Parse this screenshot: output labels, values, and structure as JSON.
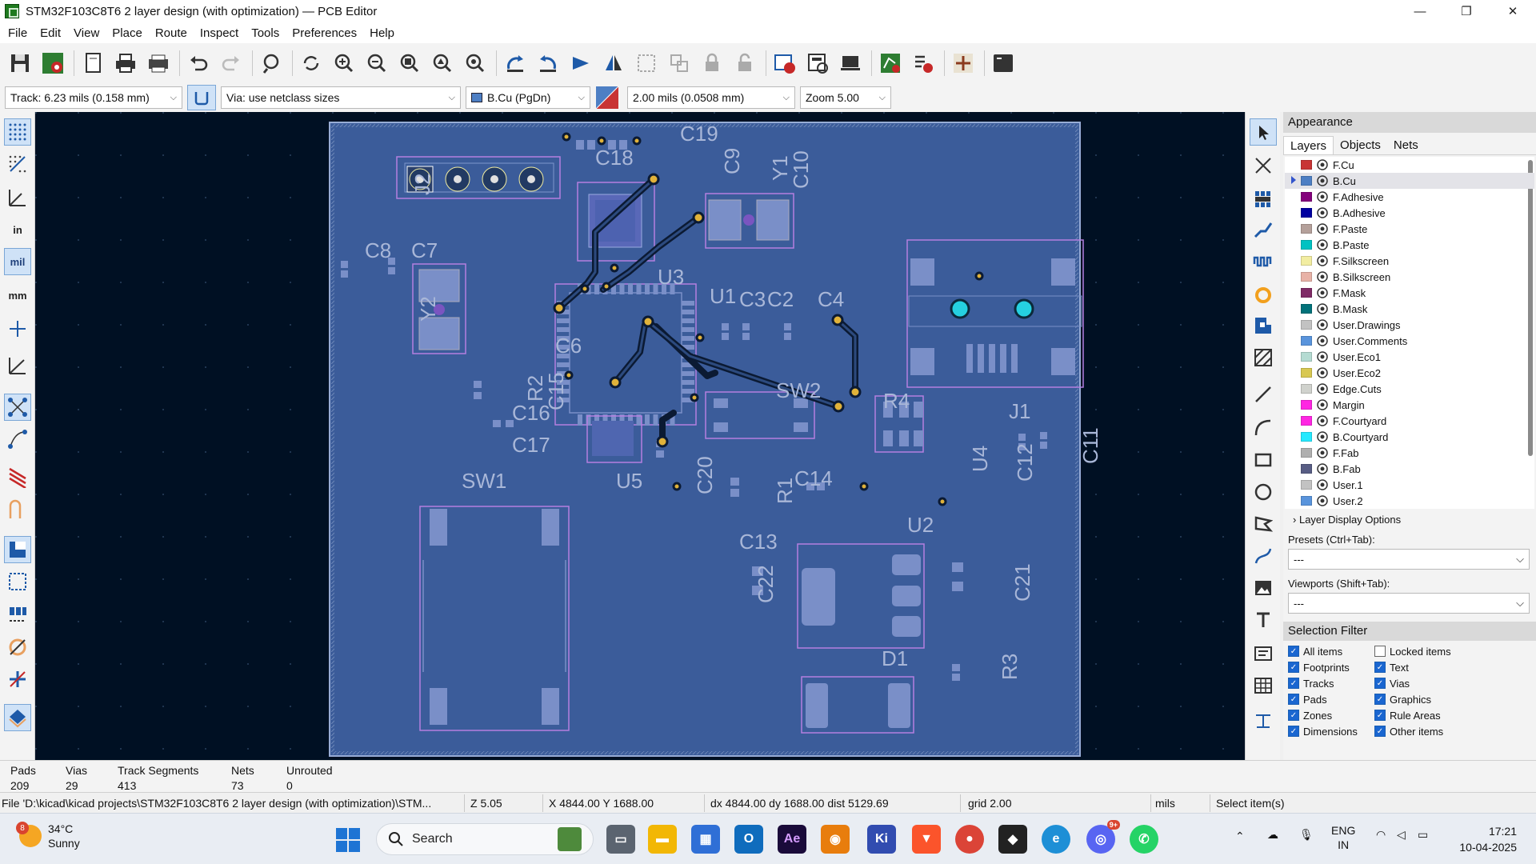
{
  "window": {
    "title": "STM32F103C8T6 2 layer design (with optimization) — PCB Editor",
    "controls": [
      "minimize",
      "restore",
      "close"
    ]
  },
  "menu": [
    "File",
    "Edit",
    "View",
    "Place",
    "Route",
    "Inspect",
    "Tools",
    "Preferences",
    "Help"
  ],
  "options": {
    "track": "Track: 6.23 mils (0.158 mm)",
    "via": "Via: use netclass sizes",
    "layer": "B.Cu (PgDn)",
    "grid": "2.00 mils (0.0508 mm)",
    "zoom": "Zoom 5.00"
  },
  "left_units": {
    "in": "in",
    "mil": "mil",
    "mm": "mm"
  },
  "pcb": {
    "refs": [
      "J2",
      "C18",
      "C19",
      "C9",
      "Y1",
      "C10",
      "C8",
      "C7",
      "U3",
      "Y2",
      "U1",
      "C3",
      "C2",
      "C4",
      "C6",
      "R2",
      "C15",
      "C16",
      "C17",
      "SW2",
      "R4",
      "U4",
      "C12",
      "C11",
      "J1",
      "R1",
      "C14",
      "C20",
      "U5",
      "SW1",
      "C13",
      "U2",
      "C22",
      "C21",
      "D1",
      "R3"
    ]
  },
  "appearance": {
    "title": "Appearance",
    "tabs": [
      "Layers",
      "Objects",
      "Nets"
    ],
    "layers": [
      {
        "name": "F.Cu",
        "color": "#c83434"
      },
      {
        "name": "B.Cu",
        "color": "#4d7fc4"
      },
      {
        "name": "F.Adhesive",
        "color": "#84007c"
      },
      {
        "name": "B.Adhesive",
        "color": "#0000a0"
      },
      {
        "name": "F.Paste",
        "color": "#b4a09a"
      },
      {
        "name": "B.Paste",
        "color": "#00c2c2"
      },
      {
        "name": "F.Silkscreen",
        "color": "#f2eda1"
      },
      {
        "name": "B.Silkscreen",
        "color": "#e8b2a7"
      },
      {
        "name": "F.Mask",
        "color": "#7f2b66"
      },
      {
        "name": "B.Mask",
        "color": "#02727a"
      },
      {
        "name": "User.Drawings",
        "color": "#c2c2c2"
      },
      {
        "name": "User.Comments",
        "color": "#5994dc"
      },
      {
        "name": "User.Eco1",
        "color": "#b4dbd2"
      },
      {
        "name": "User.Eco2",
        "color": "#d8c852"
      },
      {
        "name": "Edge.Cuts",
        "color": "#d0d2cd"
      },
      {
        "name": "Margin",
        "color": "#ff26e2"
      },
      {
        "name": "F.Courtyard",
        "color": "#ff26e2"
      },
      {
        "name": "B.Courtyard",
        "color": "#26e9ff"
      },
      {
        "name": "F.Fab",
        "color": "#afafaf"
      },
      {
        "name": "B.Fab",
        "color": "#585d84"
      },
      {
        "name": "User.1",
        "color": "#c2c2c2"
      },
      {
        "name": "User.2",
        "color": "#5994dc"
      }
    ],
    "layer_display_options": "Layer Display Options",
    "presets_label": "Presets (Ctrl+Tab):",
    "presets_value": "---",
    "viewports_label": "Viewports (Shift+Tab):",
    "viewports_value": "---"
  },
  "selection_filter": {
    "title": "Selection Filter",
    "items": [
      {
        "label": "All items",
        "checked": true
      },
      {
        "label": "Locked items",
        "checked": false
      },
      {
        "label": "Footprints",
        "checked": true
      },
      {
        "label": "Text",
        "checked": true
      },
      {
        "label": "Tracks",
        "checked": true
      },
      {
        "label": "Vias",
        "checked": true
      },
      {
        "label": "Pads",
        "checked": true
      },
      {
        "label": "Graphics",
        "checked": true
      },
      {
        "label": "Zones",
        "checked": true
      },
      {
        "label": "Rule Areas",
        "checked": true
      },
      {
        "label": "Dimensions",
        "checked": true
      },
      {
        "label": "Other items",
        "checked": true
      }
    ]
  },
  "stats": {
    "pads_label": "Pads",
    "pads": "209",
    "vias_label": "Vias",
    "vias": "29",
    "tracks_label": "Track Segments",
    "tracks": "413",
    "nets_label": "Nets",
    "nets": "73",
    "unrouted_label": "Unrouted",
    "unrouted": "0"
  },
  "status": {
    "file": "File 'D:\\kicad\\kicad projects\\STM32F103C8T6 2 layer design (with optimization)\\STM...",
    "zoom": "Z 5.05",
    "xy": "X 4844.00  Y 1688.00",
    "delta": "dx 4844.00  dy 1688.00  dist 5129.69",
    "grid": "grid 2.00",
    "units": "mils",
    "mode": "Select item(s)"
  },
  "taskbar": {
    "temp": "34°C",
    "weather": "Sunny",
    "weather_badge": "8",
    "search": "Search",
    "lang1": "ENG",
    "lang2": "IN",
    "time": "17:21",
    "date": "10-04-2025",
    "discord_badge": "9+"
  }
}
